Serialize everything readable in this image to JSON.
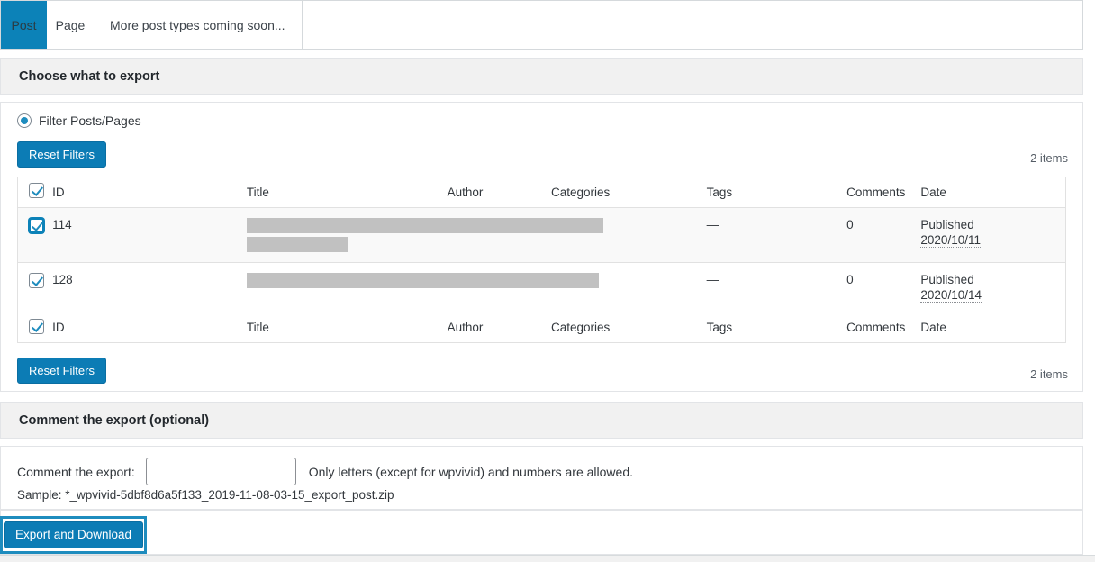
{
  "tabs": [
    {
      "label": "Post",
      "active": true
    },
    {
      "label": "Page",
      "active": false
    },
    {
      "label": "More post types coming soon...",
      "active": false
    }
  ],
  "sections": {
    "choose_export_title": "Choose what to export",
    "comment_export_title": "Comment the export (optional)"
  },
  "filter": {
    "radio_label": "Filter Posts/Pages",
    "reset_label": "Reset Filters",
    "items_count": "2 items"
  },
  "table": {
    "columns": [
      "ID",
      "Title",
      "Author",
      "Categories",
      "Tags",
      "Comments",
      "Date"
    ],
    "rows": [
      {
        "id": "114",
        "title": "",
        "author": "",
        "categories": "",
        "tags": "—",
        "comments": "0",
        "date_status": "Published",
        "date_value": "2020/10/11",
        "checked": true,
        "focused": true
      },
      {
        "id": "128",
        "title": "",
        "author": "",
        "categories": "",
        "tags": "—",
        "comments": "0",
        "date_status": "Published",
        "date_value": "2020/10/14",
        "checked": true,
        "focused": false
      }
    ]
  },
  "comment": {
    "label": "Comment the export:",
    "value": "",
    "placeholder": "",
    "hint": "Only letters (except for wpvivid) and numbers are allowed.",
    "sample": "Sample: *_wpvivid-5dbf8d6a5f133_2019-11-08-03-15_export_post.zip"
  },
  "export": {
    "button_label": "Export and Download"
  },
  "colors": {
    "accent": "#0c7cb5",
    "tab_active": "#0c82b8",
    "focus_ring": "#1e8cbe",
    "strip_bg": "#f1f1f1",
    "redaction": "#c1c1c1"
  }
}
